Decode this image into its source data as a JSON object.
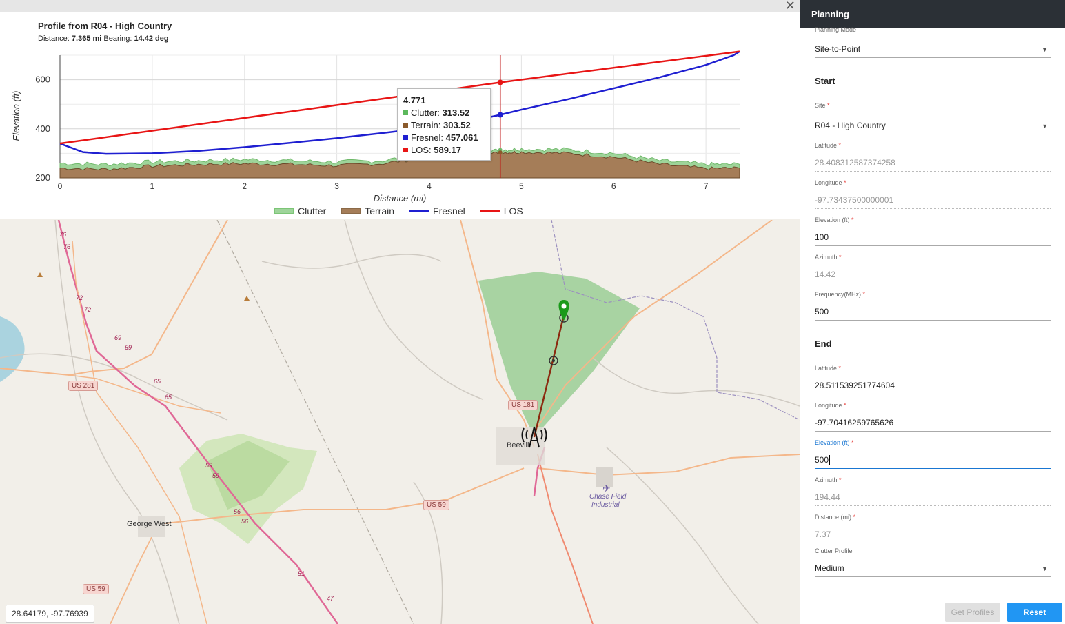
{
  "profile": {
    "title": "Profile from R04 - High Country",
    "distance_label": "Distance:",
    "distance_value": "7.365 mi",
    "bearing_label": "Bearing:",
    "bearing_value": "14.42 deg",
    "close_icon": "close-icon"
  },
  "chart_data": {
    "type": "area",
    "xlabel": "Distance (mi)",
    "ylabel": "Elevation (ft)",
    "xlim": [
      0,
      7.365
    ],
    "ylim": [
      200,
      700
    ],
    "x_ticks": [
      "0",
      "1",
      "2",
      "3",
      "4",
      "5",
      "6",
      "7"
    ],
    "y_ticks": [
      "200",
      "400",
      "600"
    ],
    "grid": true,
    "legend_position": "bottom",
    "series": [
      {
        "name": "Clutter",
        "color": "#7cc576",
        "x": [
          0,
          0.5,
          1,
          1.5,
          2,
          2.5,
          3,
          3.5,
          4,
          4.5,
          4.771,
          5,
          5.5,
          6,
          6.5,
          7,
          7.365
        ],
        "values": [
          260,
          255,
          265,
          270,
          275,
          270,
          265,
          270,
          300,
          300,
          313.52,
          318,
          315,
          300,
          270,
          255,
          255
        ]
      },
      {
        "name": "Terrain",
        "color": "#8b6a48",
        "x": [
          0,
          0.5,
          1,
          1.5,
          2,
          2.5,
          3,
          3.5,
          4,
          4.5,
          4.771,
          5,
          5.5,
          6,
          6.5,
          7,
          7.365
        ],
        "values": [
          240,
          235,
          248,
          255,
          258,
          255,
          250,
          258,
          285,
          290,
          303.52,
          305,
          300,
          285,
          255,
          238,
          240
        ]
      },
      {
        "name": "Fresnel",
        "color": "#1f1fd1",
        "x": [
          0,
          0.25,
          0.5,
          1,
          1.5,
          2,
          2.5,
          3,
          3.5,
          4,
          4.5,
          4.771,
          5,
          5.5,
          6,
          6.5,
          7,
          7.3,
          7.365
        ],
        "values": [
          340,
          305,
          298,
          300,
          310,
          325,
          343,
          362,
          383,
          405,
          435,
          457.061,
          478,
          520,
          565,
          610,
          660,
          700,
          715
        ]
      },
      {
        "name": "LOS",
        "color": "#e81515",
        "x": [
          0,
          4.771,
          7.365
        ],
        "values": [
          340,
          589.17,
          715
        ]
      }
    ],
    "cursor_x": 4.771
  },
  "tooltip": {
    "x": "4.771",
    "clutter_label": "Clutter:",
    "clutter_value": "313.52",
    "terrain_label": "Terrain:",
    "terrain_value": "303.52",
    "fresnel_label": "Fresnel:",
    "fresnel_value": "457.061",
    "los_label": "LOS:",
    "los_value": "589.17"
  },
  "legend": [
    "Clutter",
    "Terrain",
    "Fresnel",
    "LOS"
  ],
  "map": {
    "coords": "28.64179, -97.76939",
    "labels": {
      "beeville": "Beevill",
      "george_west": "George West",
      "chase_field": "Chase Field",
      "industrial": "Industrial"
    },
    "shields": {
      "us281": "US 281",
      "us181": "US 181",
      "us59a": "US 59",
      "us59b": "US 59"
    },
    "road_numbers": [
      "76",
      "76",
      "72",
      "72",
      "69",
      "69",
      "65",
      "65",
      "59",
      "59",
      "56",
      "56",
      "51",
      "47"
    ]
  },
  "planning": {
    "header": "Planning",
    "mode_label": "Planning Mode",
    "mode_value": "Site-to-Point",
    "start_heading": "Start",
    "site_label": "Site",
    "site_value": "R04 - High Country",
    "lat_label": "Latitude",
    "lat_value": "28.408312587374258",
    "lon_label": "Longitude",
    "lon_value": "-97.73437500000001",
    "elev_label": "Elevation (ft)",
    "elev_value": "100",
    "az_label": "Azimuth",
    "az_value": "14.42",
    "freq_label": "Frequency(MHz)",
    "freq_value": "500",
    "end_heading": "End",
    "end_lat_label": "Latitude",
    "end_lat_value": "28.511539251774604",
    "end_lon_label": "Longitude",
    "end_lon_value": "-97.70416259765626",
    "end_elev_label": "Elevation (ft)",
    "end_elev_value": "500",
    "end_az_label": "Azimuth",
    "end_az_value": "194.44",
    "dist_label": "Distance (mi)",
    "dist_value": "7.37",
    "clutter_label": "Clutter Profile",
    "clutter_value": "Medium",
    "get_profiles": "Get Profiles",
    "reset": "Reset",
    "required_mark": "*"
  }
}
